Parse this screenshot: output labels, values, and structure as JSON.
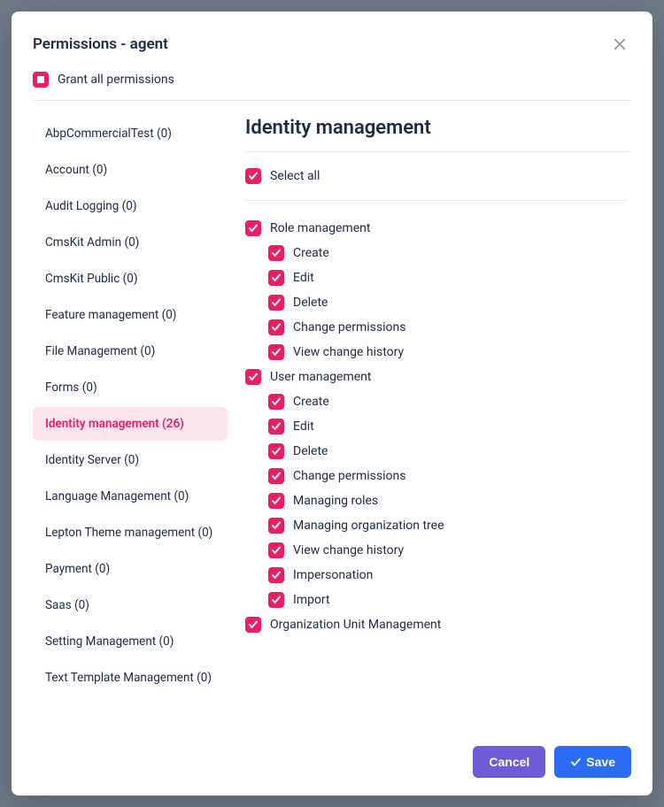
{
  "modal": {
    "title": "Permissions - agent",
    "grantAllLabel": "Grant all permissions"
  },
  "sidebar": {
    "items": [
      {
        "label": "AbpCommercialTest (0)",
        "active": false
      },
      {
        "label": "Account (0)",
        "active": false
      },
      {
        "label": "Audit Logging (0)",
        "active": false
      },
      {
        "label": "CmsKit Admin (0)",
        "active": false
      },
      {
        "label": "CmsKit Public (0)",
        "active": false
      },
      {
        "label": "Feature management (0)",
        "active": false
      },
      {
        "label": "File Management (0)",
        "active": false
      },
      {
        "label": "Forms (0)",
        "active": false
      },
      {
        "label": "Identity management (26)",
        "active": true
      },
      {
        "label": "Identity Server (0)",
        "active": false
      },
      {
        "label": "Language Management (0)",
        "active": false
      },
      {
        "label": "Lepton Theme management (0)",
        "active": false
      },
      {
        "label": "Payment (0)",
        "active": false
      },
      {
        "label": "Saas (0)",
        "active": false
      },
      {
        "label": "Setting Management (0)",
        "active": false
      },
      {
        "label": "Text Template Management (0)",
        "active": false
      }
    ]
  },
  "main": {
    "title": "Identity management",
    "selectAllLabel": "Select all",
    "groups": [
      {
        "label": "Role management",
        "children": [
          {
            "label": "Create"
          },
          {
            "label": "Edit"
          },
          {
            "label": "Delete"
          },
          {
            "label": "Change permissions"
          },
          {
            "label": "View change history"
          }
        ]
      },
      {
        "label": "User management",
        "children": [
          {
            "label": "Create"
          },
          {
            "label": "Edit"
          },
          {
            "label": "Delete"
          },
          {
            "label": "Change permissions"
          },
          {
            "label": "Managing roles"
          },
          {
            "label": "Managing organization tree"
          },
          {
            "label": "View change history"
          },
          {
            "label": "Impersonation"
          },
          {
            "label": "Import"
          }
        ]
      },
      {
        "label": "Organization Unit Management",
        "children": []
      }
    ]
  },
  "footer": {
    "cancelLabel": "Cancel",
    "saveLabel": "Save"
  }
}
